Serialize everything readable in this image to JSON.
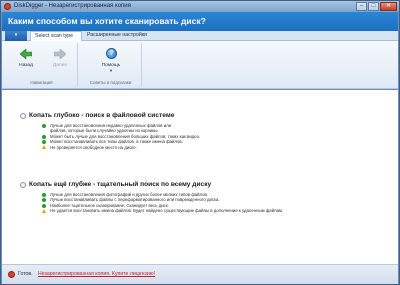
{
  "window": {
    "title": "DiskDigger - Незарегистрированная копия",
    "minimize": "–",
    "maximize": "□",
    "close": "✕"
  },
  "header": {
    "title": "Каким способом вы хотите сканировать диск?"
  },
  "tabs": {
    "file_tab": "▾",
    "items": [
      {
        "label": "Select scan type",
        "active": true
      },
      {
        "label": "Расширенные настройки",
        "active": false
      }
    ]
  },
  "ribbon": {
    "navigation": {
      "group_label": "Навигация",
      "back_label": "Назад",
      "next_label": "Далее",
      "back_icon": "arrow-left-icon",
      "next_icon": "arrow-right-icon"
    },
    "help": {
      "group_label": "Советы и подсказки",
      "help_label": "Помощь",
      "help_glyph": "?",
      "caret": "▼"
    }
  },
  "options": [
    {
      "title": "Копать глубоко - поиск в файловой системе",
      "bullets": [
        {
          "type": "ok",
          "text": "Лучше для восстановления недавно удаленных файлов или"
        },
        {
          "type": "none",
          "text": "файлов, которые были случайно удалены из корзины."
        },
        {
          "type": "ok",
          "text": "Может быть лучше для восстановления больших файлов, таких как видео."
        },
        {
          "type": "ok",
          "text": "Может восстанавливать все типы файлов, а также имена файлов."
        },
        {
          "type": "warn",
          "text": "Не проверяется свободное место на диске."
        }
      ]
    },
    {
      "title": "Копать ещё глубже - тщательный поиск по всему диску",
      "bullets": [
        {
          "type": "ok",
          "text": "Лучше для восстановления фотографий и других более мелких типов файлов."
        },
        {
          "type": "ok",
          "text": "Лучше восстанавливать файлы с переформатированного или поврежденного диска."
        },
        {
          "type": "ok",
          "text": "Наиболее тщательное сканирование. Сканирует весь диск."
        },
        {
          "type": "warn",
          "text": "Не удается восстановить имена файлов. Будет найдено существующие файлы в дополнение к удаленным файлам."
        }
      ]
    }
  ],
  "status": {
    "text": "Готов.",
    "link": "Незарегистрированная копия. Купите лицензию!"
  },
  "colors": {
    "header_bg": "#1b6fc0",
    "link": "#c4212f",
    "ok": "#2c9a35",
    "warn": "#e5a10f"
  }
}
